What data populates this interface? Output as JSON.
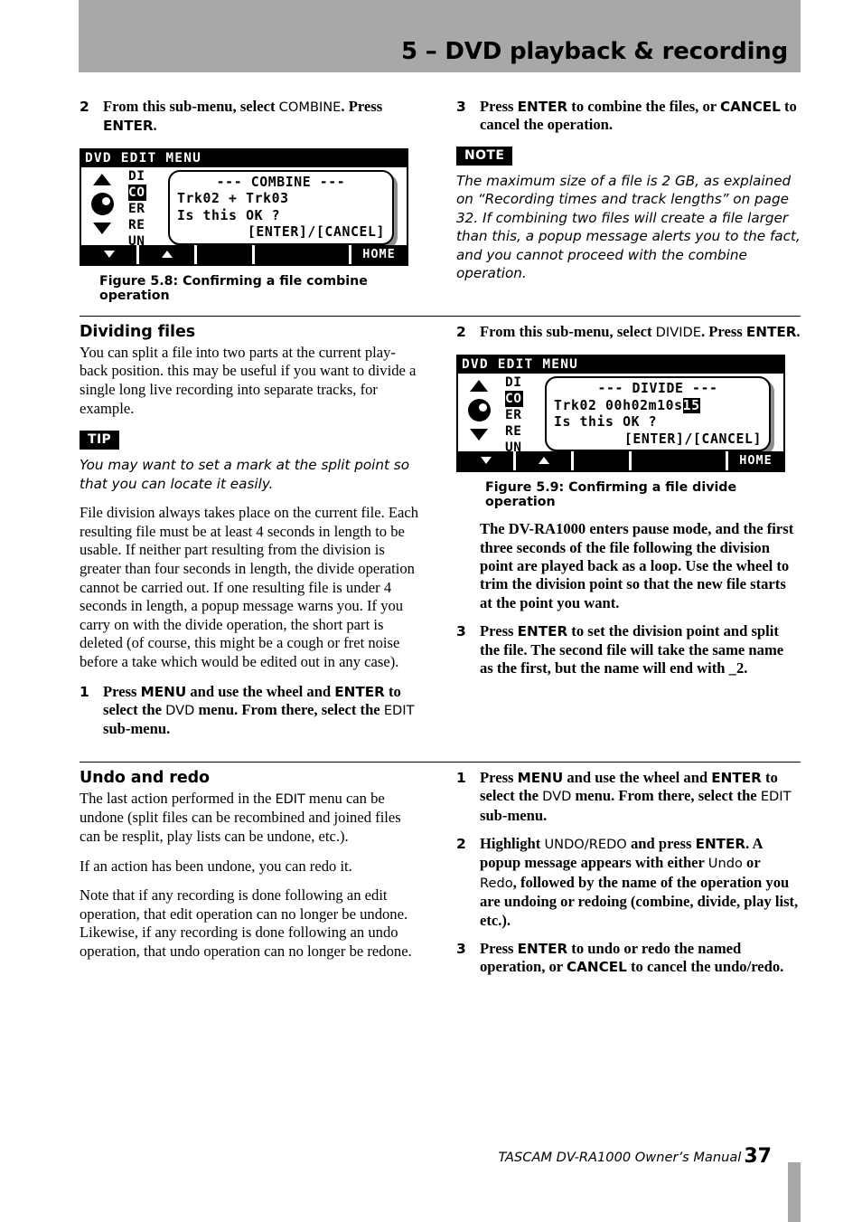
{
  "header": {
    "title": "5 – DVD playback & recording"
  },
  "left_column_top": {
    "step": {
      "num": "2",
      "text_a": "From this sub-menu, select ",
      "device": "COMBINE",
      "text_b": ". Press ",
      "key": "ENTER",
      "text_c": "."
    },
    "figure": {
      "lcd_title": "DVD EDIT MENU",
      "menu_items": [
        "DI",
        "CO",
        "ER",
        "RE",
        "UN"
      ],
      "selected_index": 1,
      "popup_line1": "--- COMBINE ---",
      "popup_line2": "Trk02 + Trk03",
      "popup_line3": "Is this OK ?",
      "popup_line4": "[ENTER]/[CANCEL]",
      "softkeys": [
        "▼",
        "▲",
        "",
        "",
        "HOME"
      ],
      "caption": "Figure 5.8: Confirming a file combine operation"
    }
  },
  "right_column_top": {
    "step": {
      "num": "3",
      "text_a": "Press ",
      "key1": "ENTER",
      "text_b": " to combine the files, or ",
      "key2": "CANCEL",
      "text_c": " to cancel the operation."
    },
    "note_badge": "NOTE",
    "note_text": "The maximum size of a file is 2 GB, as explained on “Recording times and track lengths” on page 32. If combining two files will create a file larger than this, a popup message alerts you to the fact, and you cannot proceed with the combine operation."
  },
  "dividing_files": {
    "heading": "Dividing files",
    "para1": "You can split a file into two parts at the current play-back position. this may be useful if you want to divide a single long live recording into separate tracks, for example.",
    "tip_badge": "TIP",
    "tip_text": "You may want to set a mark at the split point so that you can locate it easily.",
    "para2": "File division always takes place on the current file. Each resulting file must be at least 4 seconds in length to be usable. If neither part resulting from the division is greater than four seconds in length, the divide operation cannot be carried out. If one resulting file is under 4 seconds in length, a popup message warns you. If you carry on with the divide operation, the short part is deleted (of course, this might be a cough or fret noise before a take which would be edited out in any case).",
    "step1": {
      "num": "1",
      "text_a": "Press ",
      "key1": "MENU",
      "text_b": " and use the wheel and ",
      "key2": "ENTER",
      "text_c": " to select the ",
      "dev1": "DVD",
      "text_d": " menu. From there, select the ",
      "dev2": "EDIT",
      "text_e": " sub-menu."
    },
    "right_step2": {
      "num": "2",
      "text_a": "From this sub-menu, select ",
      "device": "DIVIDE",
      "text_b": ". Press ",
      "key": "ENTER",
      "text_c": "."
    },
    "figure": {
      "lcd_title": "DVD EDIT MENU",
      "menu_items": [
        "DI",
        "CO",
        "ER",
        "RE",
        "UN"
      ],
      "selected_index": 1,
      "popup_line1": "--- DIVIDE ---",
      "popup_line2_plain": "Trk02 00h02m10s",
      "popup_line2_highlight": "15",
      "popup_line3": "Is this OK ?",
      "popup_line4": "[ENTER]/[CANCEL]",
      "softkeys": [
        "▼",
        "▲",
        "",
        "",
        "HOME"
      ],
      "caption": "Figure 5.9: Confirming a file divide operation"
    },
    "right_para": "The DV-RA1000 enters pause mode, and the first three seconds of the file following the division point are played back as a loop. Use the wheel to trim the division point so that the new file starts at the point you want.",
    "right_step3": {
      "num": "3",
      "text_a": "Press ",
      "key": "ENTER",
      "text_b": " to set the division point and split the file. The second file will take the same name as the first, but the name will end with _2."
    }
  },
  "undo_redo": {
    "heading": "Undo and redo",
    "para1_a": "The last action performed in the ",
    "para1_dev": "EDIT",
    "para1_b": " menu can be undone (split files can be recombined and joined files can be resplit, play lists can be undone, etc.).",
    "para2": "If an action has been undone, you can redo it.",
    "para3": "Note that if any recording is done following an edit operation, that edit operation can no longer be undone. Likewise, if any recording is done following an undo operation, that undo operation can no longer be redone.",
    "step1": {
      "num": "1",
      "text_a": "Press ",
      "key1": "MENU",
      "text_b": " and use the wheel and ",
      "key2": "ENTER",
      "text_c": " to select the ",
      "dev1": "DVD",
      "text_d": " menu. From there, select the ",
      "dev2": "EDIT",
      "text_e": " sub-menu."
    },
    "step2": {
      "num": "2",
      "text_a": "Highlight ",
      "dev1": "UNDO/REDO",
      "text_b": " and press ",
      "key1": "ENTER",
      "text_c": ". A popup message appears with either ",
      "dev2": "Undo",
      "text_d": " or ",
      "dev3": "Redo",
      "text_e": ", followed by the name of the operation you are undoing or redoing (combine, divide, play list, etc.)."
    },
    "step3": {
      "num": "3",
      "text_a": "Press ",
      "key1": "ENTER",
      "text_b": " to undo or redo the named operation, or ",
      "key2": "CANCEL",
      "text_c": " to cancel the undo/redo."
    }
  },
  "footer": {
    "text": "TASCAM DV-RA1000 Owner’s Manual",
    "page": "37"
  }
}
